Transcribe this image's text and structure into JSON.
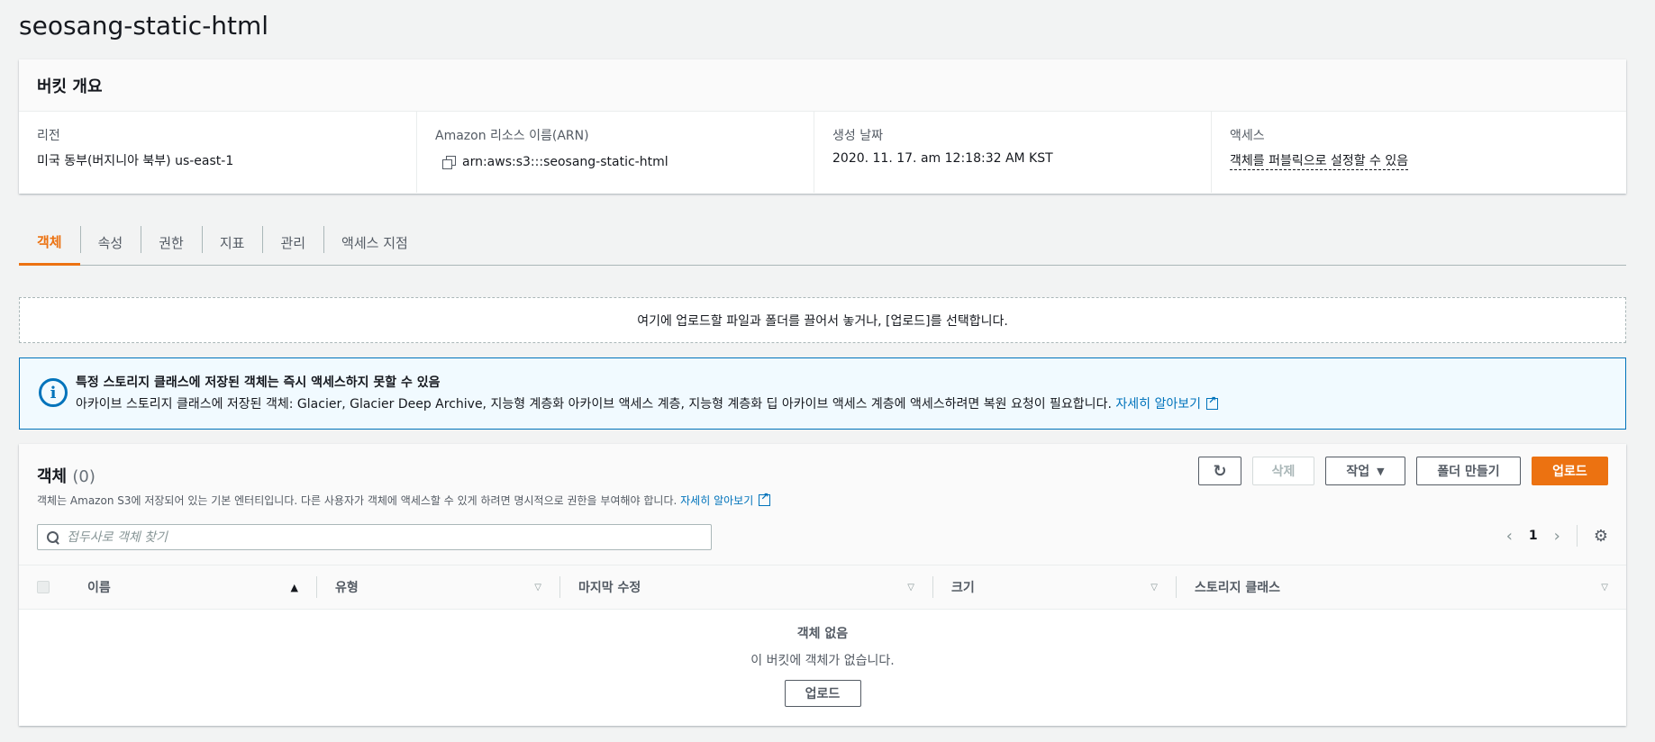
{
  "page": {
    "title": "seosang-static-html"
  },
  "overview": {
    "heading": "버킷 개요",
    "region_label": "리전",
    "region_value": "미국 동부(버지니아 북부) us-east-1",
    "arn_label": "Amazon 리소스 이름(ARN)",
    "arn_value": "arn:aws:s3:::seosang-static-html",
    "created_label": "생성 날짜",
    "created_value": "2020. 11. 17. am 12:18:32 AM KST",
    "access_label": "액세스",
    "access_value": "객체를 퍼블릭으로 설정할 수 있음"
  },
  "tabs": [
    {
      "label": "객체",
      "active": true
    },
    {
      "label": "속성"
    },
    {
      "label": "권한"
    },
    {
      "label": "지표"
    },
    {
      "label": "관리"
    },
    {
      "label": "액세스 지점"
    }
  ],
  "dropzone": {
    "text": "여기에 업로드할 파일과 폴더를 끌어서 놓거나, [업로드]를 선택합니다."
  },
  "info": {
    "title": "특정 스토리지 클래스에 저장된 객체는 즉시 액세스하지 못할 수 있음",
    "body": "아카이브 스토리지 클래스에 저장된 객체: Glacier, Glacier Deep Archive, 지능형 계층화 아카이브 액세스 계층, 지능형 계층화 딥 아카이브 액세스 계층에 액세스하려면 복원 요청이 필요합니다.",
    "link": "자세히 알아보기"
  },
  "objects": {
    "title": "객체",
    "count": "(0)",
    "description": "객체는 Amazon S3에 저장되어 있는 기본 엔터티입니다. 다른 사용자가 객체에 액세스할 수 있게 하려면 명시적으로 권한을 부여해야 합니다.",
    "learn_more": "자세히 알아보기",
    "buttons": {
      "delete": "삭제",
      "actions": "작업",
      "create_folder": "폴더 만들기",
      "upload": "업로드"
    },
    "search_placeholder": "접두사로 객체 찾기",
    "page": "1",
    "columns": {
      "name": "이름",
      "type": "유형",
      "modified": "마지막 수정",
      "size": "크기",
      "storage_class": "스토리지 클래스"
    },
    "empty_title": "객체 없음",
    "empty_text": "이 버킷에 객체가 없습니다.",
    "empty_button": "업로드"
  },
  "colors": {
    "accent": "#ec7211",
    "link": "#0073bb"
  }
}
